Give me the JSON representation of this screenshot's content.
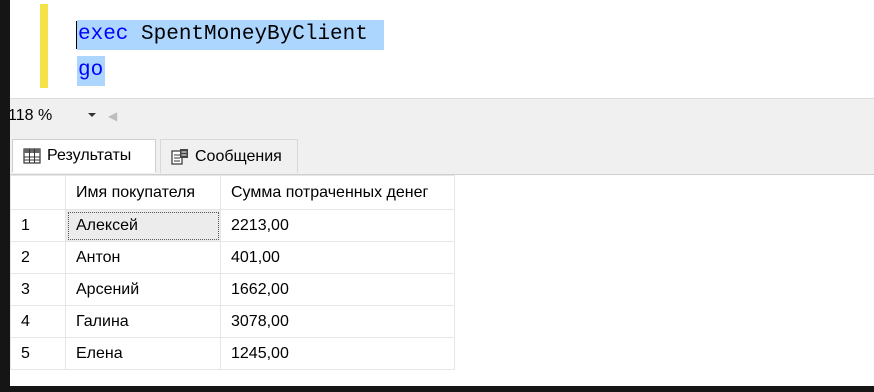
{
  "editor": {
    "line1": {
      "keyword": "exec",
      "text": " SpentMoneyByClient"
    },
    "line2": {
      "keyword": "go"
    }
  },
  "zoom": {
    "value": "118 %"
  },
  "tabs": [
    {
      "label": "Результаты",
      "icon": "grid-icon",
      "active": true
    },
    {
      "label": "Сообщения",
      "icon": "messages-icon",
      "active": false
    }
  ],
  "grid": {
    "columns": [
      "",
      "Имя покупателя",
      "Сумма потраченных денег"
    ],
    "rows": [
      [
        "1",
        "Алексей",
        "2213,00"
      ],
      [
        "2",
        "Антон",
        "401,00"
      ],
      [
        "3",
        "Арсений",
        "1662,00"
      ],
      [
        "4",
        "Галина",
        "3078,00"
      ],
      [
        "5",
        "Елена",
        "1245,00"
      ]
    ]
  },
  "colors": {
    "selection": "#add6ff",
    "keyword": "#0000ff",
    "margin": "#f3e24a",
    "background": "#151515"
  }
}
